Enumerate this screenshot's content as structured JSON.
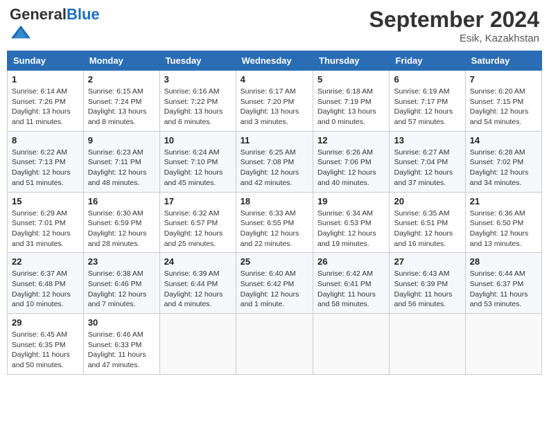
{
  "header": {
    "logo_general": "General",
    "logo_blue": "Blue",
    "month_title": "September 2024",
    "location": "Esik, Kazakhstan"
  },
  "days_of_week": [
    "Sunday",
    "Monday",
    "Tuesday",
    "Wednesday",
    "Thursday",
    "Friday",
    "Saturday"
  ],
  "weeks": [
    [
      {
        "day": "1",
        "sunrise": "6:14 AM",
        "sunset": "7:26 PM",
        "daylight": "13 hours and 11 minutes."
      },
      {
        "day": "2",
        "sunrise": "6:15 AM",
        "sunset": "7:24 PM",
        "daylight": "13 hours and 8 minutes."
      },
      {
        "day": "3",
        "sunrise": "6:16 AM",
        "sunset": "7:22 PM",
        "daylight": "13 hours and 6 minutes."
      },
      {
        "day": "4",
        "sunrise": "6:17 AM",
        "sunset": "7:20 PM",
        "daylight": "13 hours and 3 minutes."
      },
      {
        "day": "5",
        "sunrise": "6:18 AM",
        "sunset": "7:19 PM",
        "daylight": "13 hours and 0 minutes."
      },
      {
        "day": "6",
        "sunrise": "6:19 AM",
        "sunset": "7:17 PM",
        "daylight": "12 hours and 57 minutes."
      },
      {
        "day": "7",
        "sunrise": "6:20 AM",
        "sunset": "7:15 PM",
        "daylight": "12 hours and 54 minutes."
      }
    ],
    [
      {
        "day": "8",
        "sunrise": "6:22 AM",
        "sunset": "7:13 PM",
        "daylight": "12 hours and 51 minutes."
      },
      {
        "day": "9",
        "sunrise": "6:23 AM",
        "sunset": "7:11 PM",
        "daylight": "12 hours and 48 minutes."
      },
      {
        "day": "10",
        "sunrise": "6:24 AM",
        "sunset": "7:10 PM",
        "daylight": "12 hours and 45 minutes."
      },
      {
        "day": "11",
        "sunrise": "6:25 AM",
        "sunset": "7:08 PM",
        "daylight": "12 hours and 42 minutes."
      },
      {
        "day": "12",
        "sunrise": "6:26 AM",
        "sunset": "7:06 PM",
        "daylight": "12 hours and 40 minutes."
      },
      {
        "day": "13",
        "sunrise": "6:27 AM",
        "sunset": "7:04 PM",
        "daylight": "12 hours and 37 minutes."
      },
      {
        "day": "14",
        "sunrise": "6:28 AM",
        "sunset": "7:02 PM",
        "daylight": "12 hours and 34 minutes."
      }
    ],
    [
      {
        "day": "15",
        "sunrise": "6:29 AM",
        "sunset": "7:01 PM",
        "daylight": "12 hours and 31 minutes."
      },
      {
        "day": "16",
        "sunrise": "6:30 AM",
        "sunset": "6:59 PM",
        "daylight": "12 hours and 28 minutes."
      },
      {
        "day": "17",
        "sunrise": "6:32 AM",
        "sunset": "6:57 PM",
        "daylight": "12 hours and 25 minutes."
      },
      {
        "day": "18",
        "sunrise": "6:33 AM",
        "sunset": "6:55 PM",
        "daylight": "12 hours and 22 minutes."
      },
      {
        "day": "19",
        "sunrise": "6:34 AM",
        "sunset": "6:53 PM",
        "daylight": "12 hours and 19 minutes."
      },
      {
        "day": "20",
        "sunrise": "6:35 AM",
        "sunset": "6:51 PM",
        "daylight": "12 hours and 16 minutes."
      },
      {
        "day": "21",
        "sunrise": "6:36 AM",
        "sunset": "6:50 PM",
        "daylight": "12 hours and 13 minutes."
      }
    ],
    [
      {
        "day": "22",
        "sunrise": "6:37 AM",
        "sunset": "6:48 PM",
        "daylight": "12 hours and 10 minutes."
      },
      {
        "day": "23",
        "sunrise": "6:38 AM",
        "sunset": "6:46 PM",
        "daylight": "12 hours and 7 minutes."
      },
      {
        "day": "24",
        "sunrise": "6:39 AM",
        "sunset": "6:44 PM",
        "daylight": "12 hours and 4 minutes."
      },
      {
        "day": "25",
        "sunrise": "6:40 AM",
        "sunset": "6:42 PM",
        "daylight": "12 hours and 1 minute."
      },
      {
        "day": "26",
        "sunrise": "6:42 AM",
        "sunset": "6:41 PM",
        "daylight": "11 hours and 58 minutes."
      },
      {
        "day": "27",
        "sunrise": "6:43 AM",
        "sunset": "6:39 PM",
        "daylight": "11 hours and 56 minutes."
      },
      {
        "day": "28",
        "sunrise": "6:44 AM",
        "sunset": "6:37 PM",
        "daylight": "11 hours and 53 minutes."
      }
    ],
    [
      {
        "day": "29",
        "sunrise": "6:45 AM",
        "sunset": "6:35 PM",
        "daylight": "11 hours and 50 minutes."
      },
      {
        "day": "30",
        "sunrise": "6:46 AM",
        "sunset": "6:33 PM",
        "daylight": "11 hours and 47 minutes."
      },
      null,
      null,
      null,
      null,
      null
    ]
  ]
}
